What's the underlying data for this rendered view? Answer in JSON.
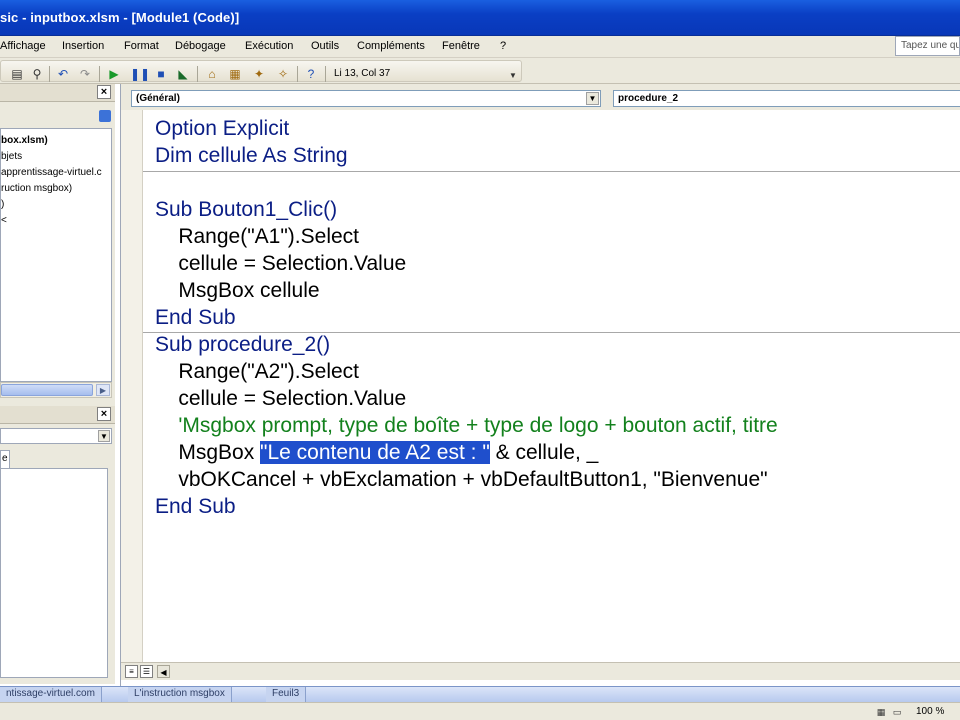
{
  "window": {
    "title": "sic - inputbox.xlsm - [Module1 (Code)]"
  },
  "menu": {
    "items": [
      "Affichage",
      "Insertion",
      "Format",
      "Débogage",
      "Exécution",
      "Outils",
      "Compléments",
      "Fenêtre",
      "?"
    ],
    "help_placeholder": "Tapez une qu"
  },
  "toolbar": {
    "cursor_position": "Li 13, Col 37",
    "icons": [
      "paste-icon",
      "find-icon",
      "undo-icon",
      "redo-icon",
      "run-icon",
      "break-icon",
      "reset-icon",
      "design-mode-icon",
      "project-explorer-icon",
      "properties-icon",
      "object-browser-icon",
      "toolbox-icon",
      "help-icon"
    ]
  },
  "project_explorer": {
    "close_label": "×",
    "items": [
      "box.xlsm)",
      "bjets",
      "apprentissage-virtuel.c",
      "ruction msgbox)",
      ")",
      "<"
    ]
  },
  "properties": {
    "close_label": "×",
    "tab_label": "e"
  },
  "code_window": {
    "object_combo": "(Général)",
    "procedure_combo": "procedure_2",
    "lines": [
      {
        "text": "Option Explicit",
        "type": "keyword"
      },
      {
        "text": "Dim cellule As String",
        "type": "keyword"
      },
      {
        "text": "",
        "type": "blank"
      },
      {
        "text": "Sub Bouton1_Clic()",
        "type": "keyword"
      },
      {
        "text": "    Range(\"A1\").Select",
        "type": "code"
      },
      {
        "text": "    cellule = Selection.Value",
        "type": "code"
      },
      {
        "text": "    MsgBox cellule",
        "type": "code"
      },
      {
        "text": "End Sub",
        "type": "keyword"
      },
      {
        "text": "Sub procedure_2()",
        "type": "keyword"
      },
      {
        "text": "    Range(\"A2\").Select",
        "type": "code"
      },
      {
        "text": "    cellule = Selection.Value",
        "type": "code"
      },
      {
        "text": "    'Msgbox prompt, type de boîte + type de logo + bouton actif, titre",
        "type": "comment"
      },
      {
        "text": "",
        "type": "selected"
      },
      {
        "text": "    vbOKCancel + vbExclamation + vbDefaultButton1, \"Bienvenue\"",
        "type": "code"
      },
      {
        "text": "End Sub",
        "type": "keyword"
      }
    ],
    "selected_line": {
      "before": "    MsgBox ",
      "selection": "\"Le contenu de A2 est : \"",
      "after": " & cellule, _"
    }
  },
  "sheet_tabs": [
    "ntissage-virtuel.com",
    "L'instruction msgbox",
    "Feuil3"
  ],
  "status": {
    "zoom": "100 %"
  }
}
